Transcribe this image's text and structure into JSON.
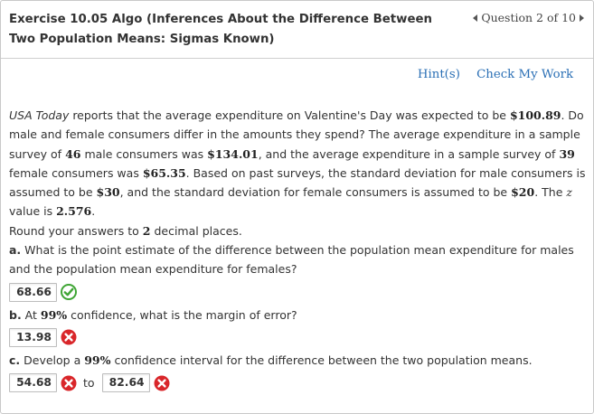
{
  "header": {
    "title": "Exercise 10.05 Algo (Inferences About the Difference Between Two Population Means: Sigmas Known)",
    "question_nav": "Question 2 of 10"
  },
  "links": {
    "hint": "Hint(s)",
    "check": "Check My Work"
  },
  "problem": {
    "publication": "USA Today",
    "t1": " reports that the average expenditure on Valentine's Day was expected to be ",
    "v1": "$100.89",
    "t2": ". Do male and female consumers differ in the amounts they spend? The average expenditure in a sample survey of ",
    "v2": "46",
    "t3": " male consumers was ",
    "v3": "$134.01",
    "t4": ", and the average expenditure in a sample survey of ",
    "v4": "39",
    "t5": " female consumers was ",
    "v5": "$65.35",
    "t6": ". Based on past surveys, the standard deviation for male consumers is assumed to be ",
    "v6": "$30",
    "t7": ", and the standard deviation for female consumers is assumed to be ",
    "v7": "$20",
    "t8": ". The ",
    "z": "z",
    "t9": " value is ",
    "v8": "2.576",
    "t10": "."
  },
  "round": {
    "pre": "Round your answers to ",
    "num": "2",
    "post": " decimal places."
  },
  "qa": {
    "label": "a.",
    "text": " What is the point estimate of the difference between the population mean expenditure for males and the population mean expenditure for females?",
    "answer": "68.66",
    "status": "correct"
  },
  "qb": {
    "label": "b.",
    "pre": " At ",
    "pct": "99%",
    "post": " confidence, what is the margin of error?",
    "answer": "13.98",
    "status": "incorrect"
  },
  "qc": {
    "label": "c.",
    "pre": " Develop a ",
    "pct": "99%",
    "post": " confidence interval for the difference between the two population means.",
    "answer_low": "54.68",
    "to": "to",
    "answer_high": "82.64",
    "status": "incorrect"
  },
  "colors": {
    "correct": "#3fa535",
    "incorrect": "#d9262a",
    "link": "#2a6fb5"
  }
}
